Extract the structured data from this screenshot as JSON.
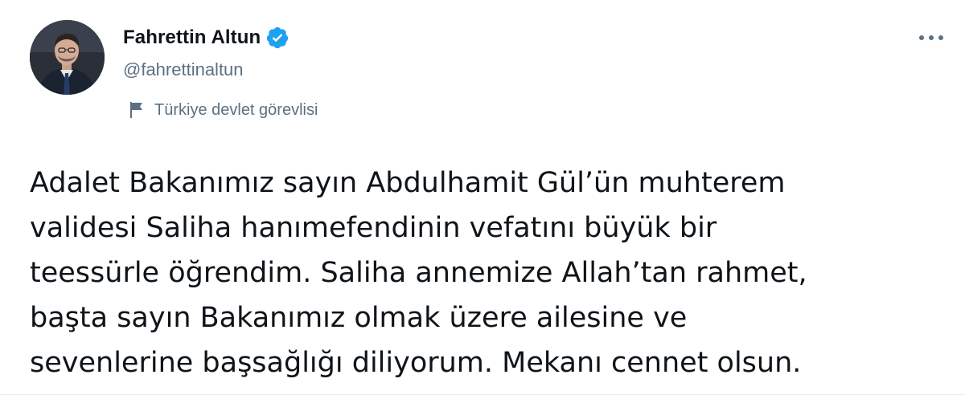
{
  "author": {
    "display_name": "Fahrettin Altun",
    "handle": "@fahrettinaltun",
    "verified": true,
    "label": "Türkiye devlet görevlisi"
  },
  "icons": {
    "verified": "verified-badge-icon",
    "label": "flag-icon",
    "more": "more-options-icon"
  },
  "colors": {
    "verified_blue": "#1da1f2",
    "secondary_text": "#5b7083",
    "primary_text": "#0f1419"
  },
  "tweet": {
    "text": "Adalet Bakanımız sayın Abdulhamit Gül’ün muhterem\nvalidesi Saliha hanımefendinin vefatını büyük bir\nteessürle öğrendim. Saliha annemize Allah’tan rahmet,\nbaşta sayın Bakanımız olmak üzere ailesine ve\nsevenlerine başsağlığı diliyorum. Mekanı cennet olsun."
  }
}
